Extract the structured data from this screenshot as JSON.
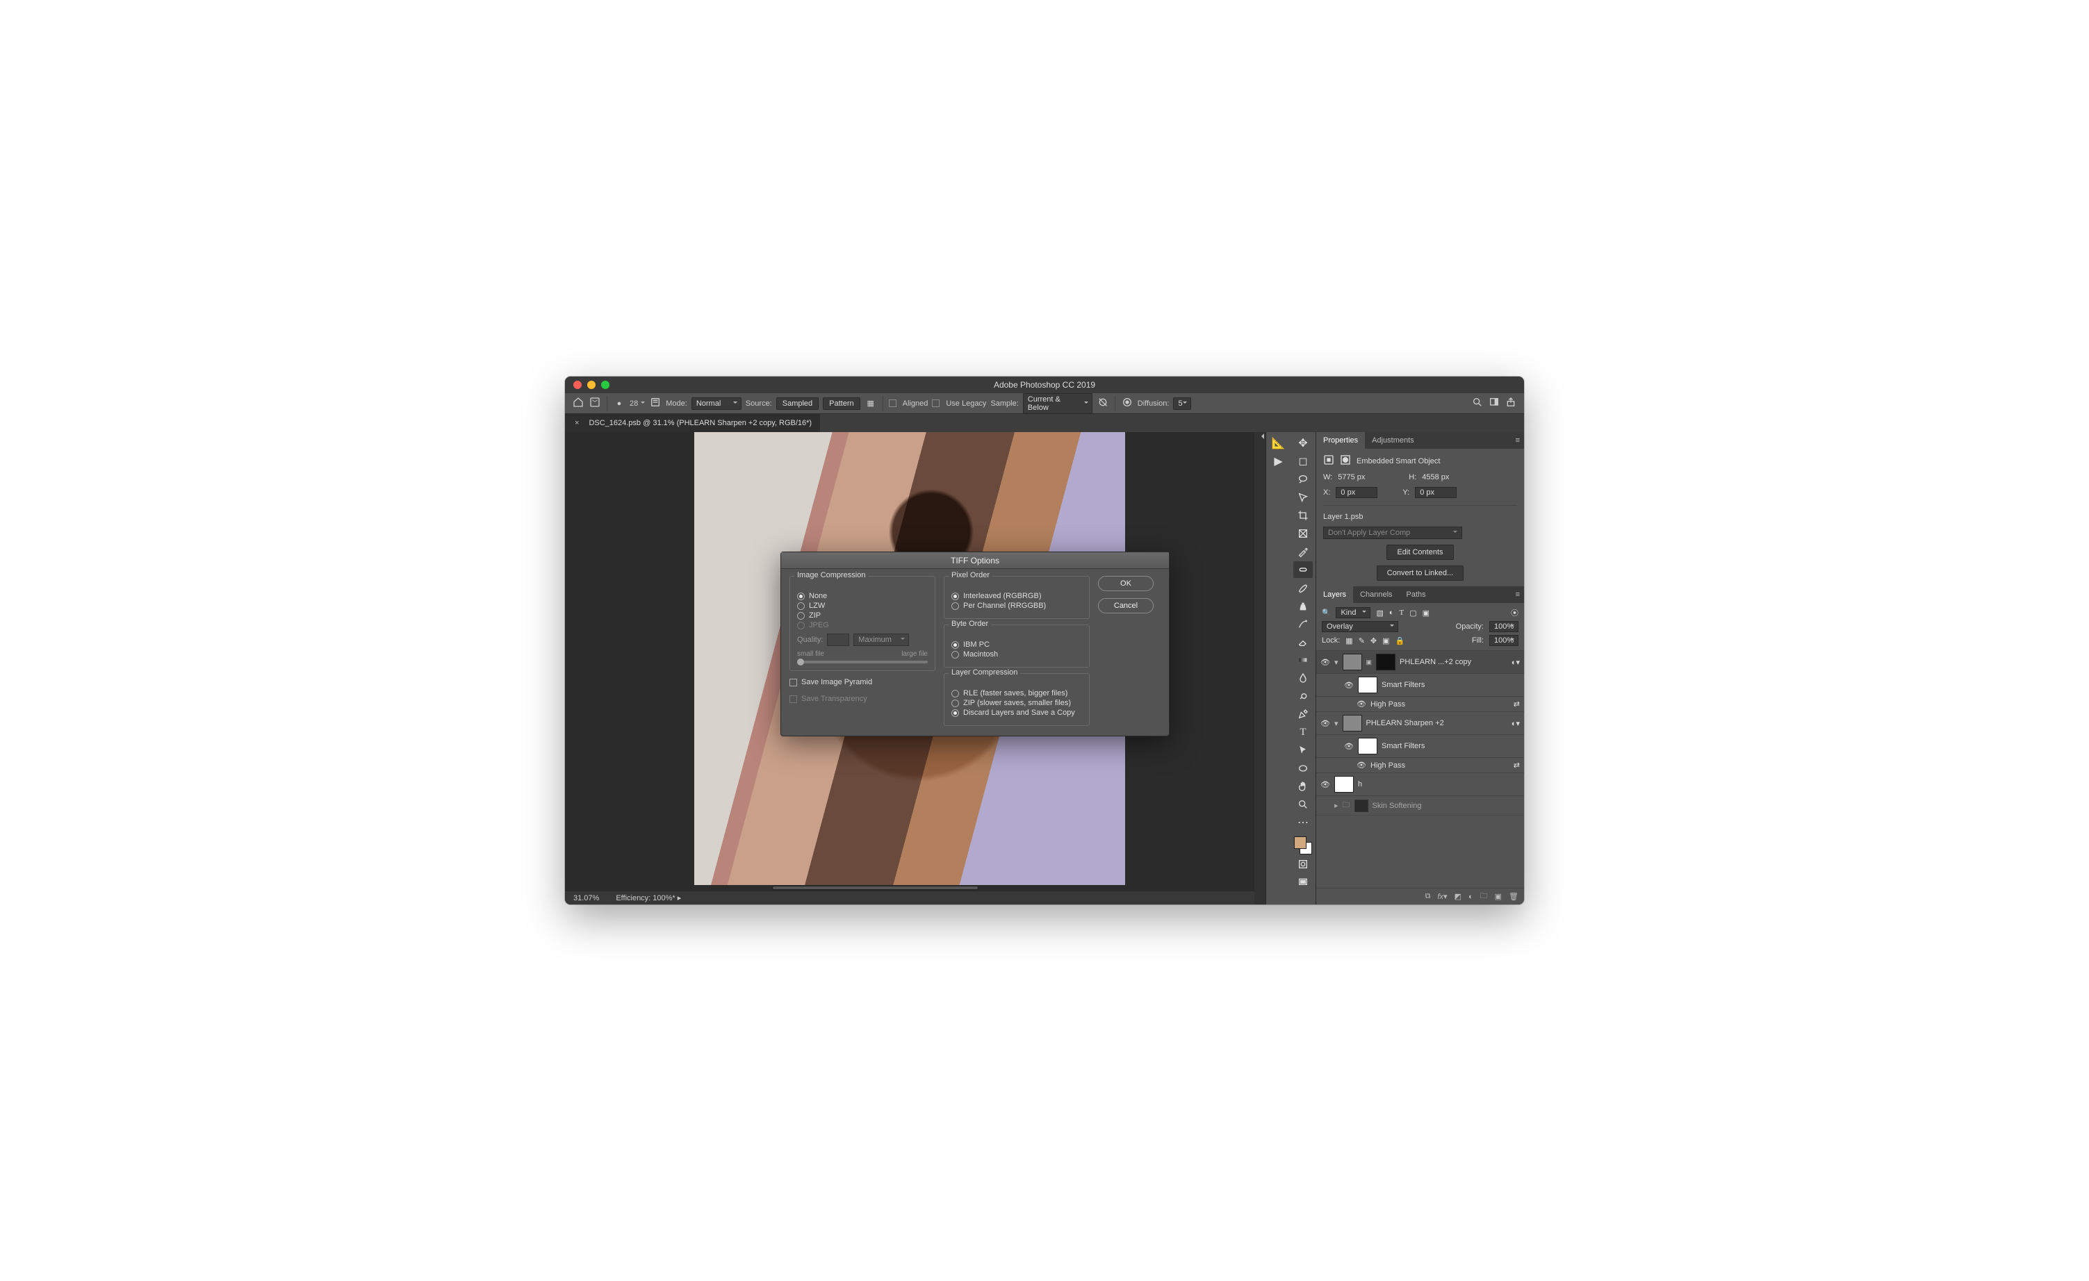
{
  "titlebar": {
    "title": "Adobe Photoshop CC 2019"
  },
  "optbar": {
    "brush_size": "28",
    "mode_label": "Mode:",
    "mode_value": "Normal",
    "source_label": "Source:",
    "source_sampled": "Sampled",
    "source_pattern": "Pattern",
    "aligned": "Aligned",
    "legacy": "Use Legacy",
    "sample_label": "Sample:",
    "sample_value": "Current & Below",
    "diffusion_label": "Diffusion:",
    "diffusion_value": "5"
  },
  "doctab": {
    "label": "DSC_1624.psb @ 31.1% (PHLEARN Sharpen +2 copy, RGB/16*)"
  },
  "status": {
    "zoom": "31.07%",
    "efficiency": "Efficiency: 100%*"
  },
  "properties": {
    "panel_tabs": {
      "properties": "Properties",
      "adjustments": "Adjustments"
    },
    "type_label": "Embedded Smart Object",
    "w_label": "W:",
    "w_value": "5775 px",
    "h_label": "H:",
    "h_value": "4558 px",
    "x_label": "X:",
    "x_value": "0 px",
    "y_label": "Y:",
    "y_value": "0 px",
    "file": "Layer 1.psb",
    "layer_comp": "Don't Apply Layer Comp",
    "edit_contents": "Edit Contents",
    "convert_linked": "Convert to Linked..."
  },
  "layers": {
    "panel_tabs": {
      "layers": "Layers",
      "channels": "Channels",
      "paths": "Paths"
    },
    "kind_label": "Kind",
    "blend_mode": "Overlay",
    "opacity_label": "Opacity:",
    "opacity_value": "100%",
    "lock_label": "Lock:",
    "fill_label": "Fill:",
    "fill_value": "100%",
    "items": [
      {
        "name": "PHLEARN ...+2 copy",
        "smart_filters": "Smart Filters",
        "filter": "High Pass"
      },
      {
        "name": "PHLEARN Sharpen +2",
        "smart_filters": "Smart Filters",
        "filter": "High Pass"
      },
      {
        "name": "h"
      },
      {
        "name": "Skin Softening"
      }
    ]
  },
  "dialog": {
    "title": "TIFF Options",
    "image_compression": {
      "legend": "Image Compression",
      "none": "None",
      "lzw": "LZW",
      "zip": "ZIP",
      "jpeg": "JPEG",
      "quality_label": "Quality:",
      "quality_preset": "Maximum",
      "small_file": "small file",
      "large_file": "large file"
    },
    "save_pyramid": "Save Image Pyramid",
    "save_transparency": "Save Transparency",
    "pixel_order": {
      "legend": "Pixel Order",
      "interleaved": "Interleaved (RGBRGB)",
      "per_channel": "Per Channel (RRGGBB)"
    },
    "byte_order": {
      "legend": "Byte Order",
      "ibm": "IBM PC",
      "mac": "Macintosh"
    },
    "layer_compression": {
      "legend": "Layer Compression",
      "rle": "RLE (faster saves, bigger files)",
      "zip": "ZIP (slower saves, smaller files)",
      "discard": "Discard Layers and Save a Copy"
    },
    "ok": "OK",
    "cancel": "Cancel"
  }
}
